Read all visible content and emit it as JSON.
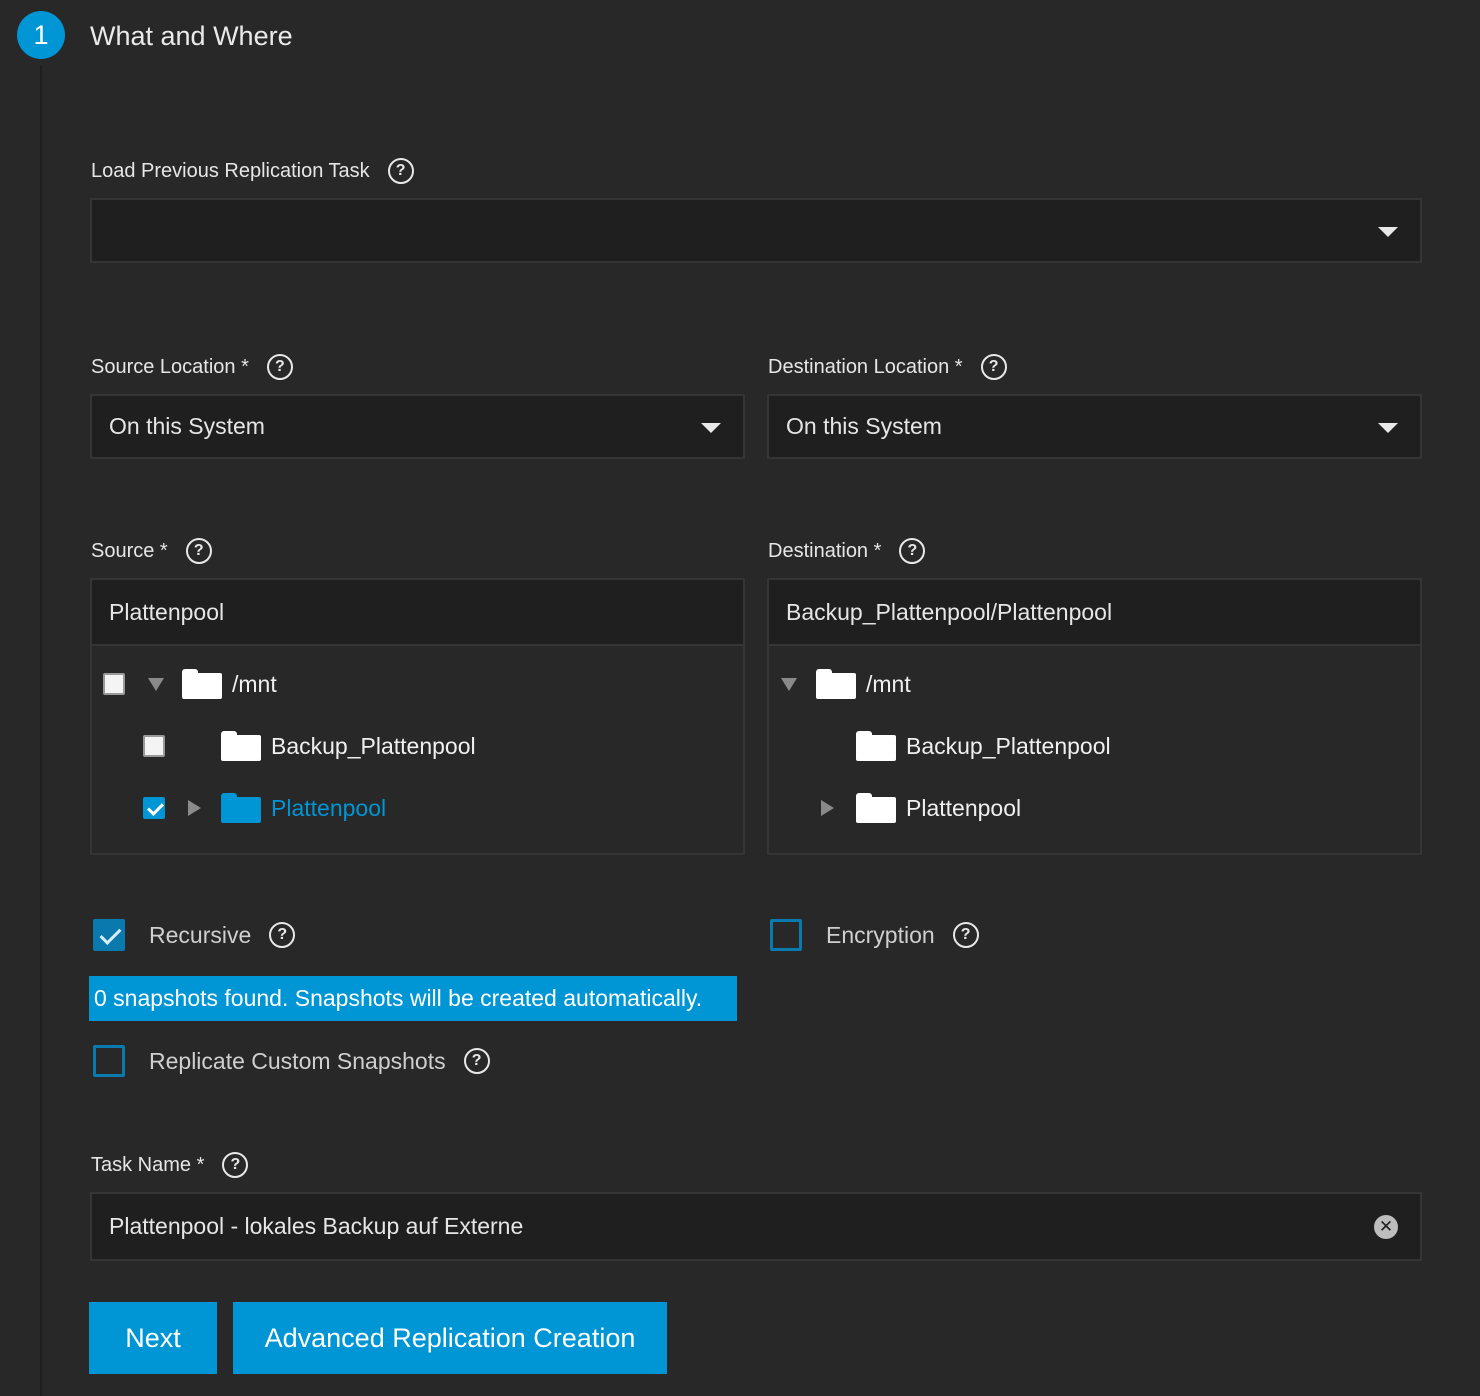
{
  "step": {
    "number": "1",
    "title": "What and Where"
  },
  "load_task": {
    "label": "Load Previous Replication Task",
    "value": ""
  },
  "source_location": {
    "label": "Source Location *",
    "value": "On this System"
  },
  "destination_location": {
    "label": "Destination Location *",
    "value": "On this System"
  },
  "source": {
    "label": "Source *",
    "value": "Plattenpool",
    "tree": [
      {
        "label": "/mnt",
        "checked": false,
        "expanded": true,
        "level": 0
      },
      {
        "label": "Backup_Plattenpool",
        "checked": false,
        "level": 1
      },
      {
        "label": "Plattenpool",
        "checked": true,
        "expanded": false,
        "level": 1,
        "selected": true
      }
    ]
  },
  "destination": {
    "label": "Destination *",
    "value": "Backup_Plattenpool/Plattenpool",
    "tree": [
      {
        "label": "/mnt",
        "expanded": true,
        "level": 0
      },
      {
        "label": "Backup_Plattenpool",
        "level": 1
      },
      {
        "label": "Plattenpool",
        "expanded": false,
        "level": 1
      }
    ]
  },
  "recursive": {
    "label": "Recursive",
    "checked": true
  },
  "encryption": {
    "label": "Encryption",
    "checked": false
  },
  "snapshot_notice": "0 snapshots found. Snapshots will be created automatically.",
  "custom_snapshots": {
    "label": "Replicate Custom Snapshots",
    "checked": false
  },
  "task_name": {
    "label": "Task Name *",
    "value": "Plattenpool - lokales Backup auf Externe"
  },
  "buttons": {
    "next": "Next",
    "advanced": "Advanced Replication Creation"
  },
  "colors": {
    "accent": "#0095d5",
    "background": "#282828",
    "field": "#1f1f1f"
  }
}
